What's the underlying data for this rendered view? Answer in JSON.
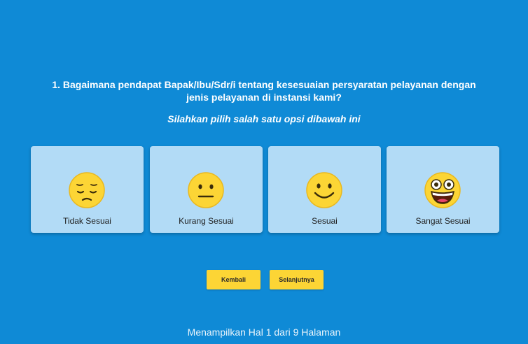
{
  "question": {
    "text": "1. Bagaimana pendapat Bapak/Ibu/Sdr/i tentang kesesuaian persyaratan pelayanan dengan jenis pelayanan di instansi kami?",
    "instruction": "Silahkan pilih salah satu opsi dibawah ini"
  },
  "options": [
    {
      "label": "Tidak Sesuai",
      "icon": "sad-face-icon"
    },
    {
      "label": "Kurang Sesuai",
      "icon": "neutral-face-icon"
    },
    {
      "label": "Sesuai",
      "icon": "smiling-face-icon"
    },
    {
      "label": "Sangat Sesuai",
      "icon": "grinning-face-icon"
    }
  ],
  "navigation": {
    "back_label": "Kembali",
    "next_label": "Selanjutnya"
  },
  "footer": {
    "page_info": "Menampilkan Hal 1 dari 9 Halaman"
  },
  "colors": {
    "background": "#0f8ad6",
    "card": "#b2dbf6",
    "button": "#fcd535",
    "emoji": "#fcd535"
  }
}
